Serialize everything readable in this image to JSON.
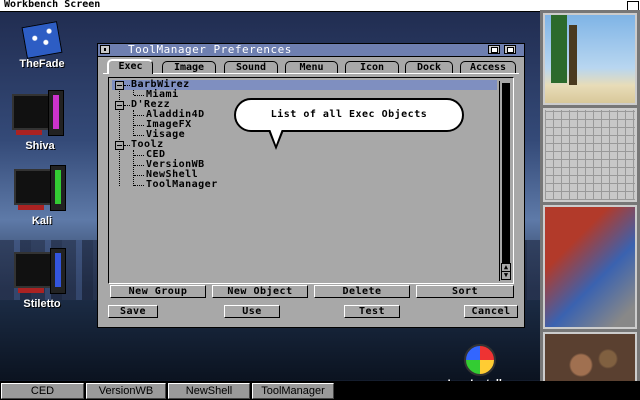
{
  "screen": {
    "title": "Workbench Screen"
  },
  "desktop_icons": [
    {
      "label": "TheFade"
    },
    {
      "label": "Shiva",
      "accent": "#cc33cc"
    },
    {
      "label": "Kali",
      "accent": "#33cc33"
    },
    {
      "label": "Stiletto",
      "accent": "#3355dd"
    }
  ],
  "window": {
    "title": "ToolManager Preferences",
    "tabs": [
      "Exec",
      "Image",
      "Sound",
      "Menu",
      "Icon",
      "Dock",
      "Access"
    ],
    "active_tab": "Exec",
    "tree": [
      {
        "label": "BarbWirez",
        "level": 0,
        "group": true,
        "selected": true
      },
      {
        "label": "Miami",
        "level": 1
      },
      {
        "label": "D'Rezz",
        "level": 0,
        "group": true
      },
      {
        "label": "Aladdin4D",
        "level": 1
      },
      {
        "label": "ImageFX",
        "level": 1
      },
      {
        "label": "Visage",
        "level": 1
      },
      {
        "label": "Toolz",
        "level": 0,
        "group": true
      },
      {
        "label": "CED",
        "level": 1
      },
      {
        "label": "VersionWB",
        "level": 1
      },
      {
        "label": "NewShell",
        "level": 1
      },
      {
        "label": "ToolManager",
        "level": 1
      }
    ],
    "list_buttons": {
      "new_group": "New Group",
      "new_object": "New Object",
      "delete": "Delete",
      "sort": "Sort"
    },
    "bottom_buttons": {
      "save": "Save",
      "use": "Use",
      "test": "Test",
      "cancel": "Cancel"
    },
    "tooltip": "List of all Exec Objects"
  },
  "taskbar": [
    "CED",
    "VersionWB",
    "NewShell",
    "ToolManager"
  ],
  "icon_installer": {
    "label": "IconInstaller"
  },
  "colors": {
    "title_active": "#6e7fb0",
    "selection": "#7f8fc0",
    "window_bg": "#a8a8a8"
  }
}
